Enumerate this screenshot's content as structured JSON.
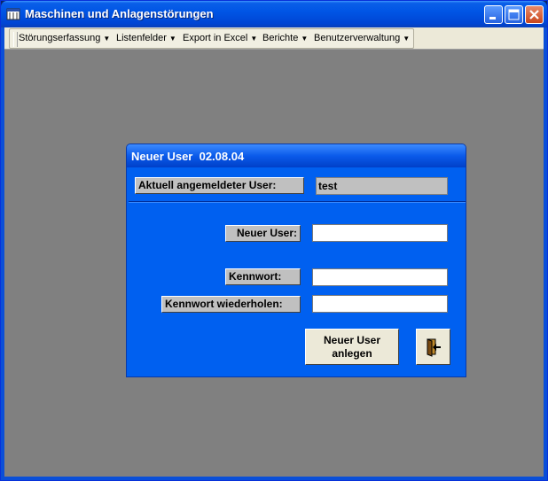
{
  "window": {
    "title": "Maschinen und Anlagenstörungen"
  },
  "menubar": {
    "items": [
      {
        "label": "Störungserfassung"
      },
      {
        "label": "Listenfelder"
      },
      {
        "label": "Export in Excel"
      },
      {
        "label": "Berichte"
      },
      {
        "label": "Benutzerverwaltung"
      }
    ],
    "arrow": "▼"
  },
  "dialog": {
    "title": "Neuer User  02.08.04",
    "current_user_label": "Aktuell angemeldeter User:",
    "current_user_value": "test",
    "new_user_label": "Neuer User:",
    "new_user_value": "",
    "password_label": "Kennwort:",
    "password_value": "",
    "password_repeat_label": "Kennwort wiederholen:",
    "password_repeat_value": "",
    "create_button_line1": "Neuer User",
    "create_button_line2": "anlegen"
  },
  "icons": {
    "app": "app-icon",
    "exit": "exit-door-icon"
  },
  "colors": {
    "workspace": "#808080",
    "dialog_bg": "#0060f0",
    "label_bg": "#c0c0c0"
  }
}
